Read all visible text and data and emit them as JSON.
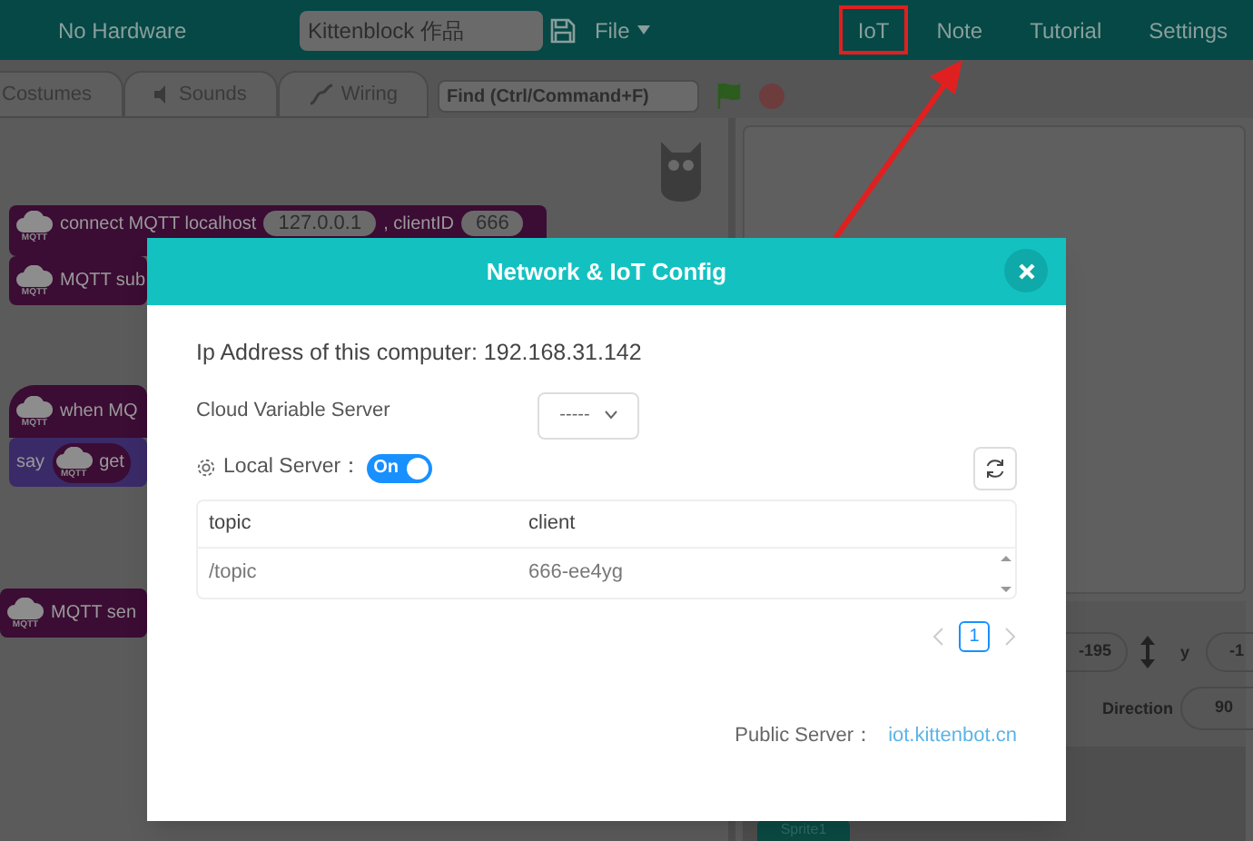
{
  "top_bar": {
    "hardware": "No Hardware",
    "project_name": "Kittenblock 作品",
    "menus": [
      {
        "label": "File",
        "kind": "dropdown",
        "highlighted": false
      },
      {
        "label": "IoT",
        "kind": "link",
        "highlighted": true
      },
      {
        "label": "Note",
        "kind": "link",
        "highlighted": false
      },
      {
        "label": "Tutorial",
        "kind": "link",
        "highlighted": false
      },
      {
        "label": "Settings",
        "kind": "link",
        "highlighted": false
      }
    ]
  },
  "editor_tabs": [
    {
      "label": "Costumes"
    },
    {
      "label": "Sounds"
    },
    {
      "label": "Wiring"
    }
  ],
  "find_field": {
    "placeholder": "Find (Ctrl/Command+F)"
  },
  "blocks": [
    {
      "kind": "command",
      "color": "#3b0c34",
      "icon_label": "MQTT",
      "parts": [
        {
          "kind": "text",
          "text": "connect MQTT localhost"
        },
        {
          "kind": "input",
          "text": "127.0.0.1"
        },
        {
          "kind": "text",
          "text": ", clientID"
        },
        {
          "kind": "input",
          "text": "666"
        }
      ]
    },
    {
      "kind": "command",
      "color": "#3b0c34",
      "icon_label": "MQTT",
      "parts": [
        {
          "kind": "text",
          "text": "MQTT sub"
        }
      ]
    },
    {
      "kind": "hat",
      "color": "#3b0c34",
      "icon_label": "MQTT",
      "parts": [
        {
          "kind": "text",
          "text": "when MQ"
        }
      ]
    },
    {
      "kind": "command",
      "color": "#3a2a68",
      "parts": [
        {
          "kind": "text",
          "text": "say"
        },
        {
          "kind": "reporter",
          "icon_label": "MQTT",
          "text": "get"
        }
      ]
    },
    {
      "kind": "command",
      "color": "#3b0c34",
      "icon_label": "MQTT",
      "parts": [
        {
          "kind": "text",
          "text": "MQTT sen"
        }
      ]
    }
  ],
  "sprite_info": {
    "x_value": "-195",
    "y_label": "y",
    "y_value": "-1",
    "direction_label": "Direction",
    "direction_value": "90"
  },
  "sprites": [
    {
      "name": "Sprite1"
    }
  ],
  "dialog": {
    "title": "Network & IoT Config",
    "ip_text": "Ip Address of this computer: 192.168.31.142",
    "cloud_label": "Cloud Variable Server",
    "cloud_select": {
      "value": "-----"
    },
    "local_server_label": "Local Server：",
    "local_server_switch": {
      "on": true,
      "label": "On"
    },
    "table": {
      "columns": [
        "topic",
        "client"
      ],
      "rows": [
        [
          "/topic",
          "666-ee4yg"
        ]
      ]
    },
    "pagination": {
      "pages": [
        {
          "label": "1",
          "selected": true
        }
      ]
    },
    "public_server_label": "Public Server：",
    "public_server_link": "iot.kittenbot.cn"
  }
}
